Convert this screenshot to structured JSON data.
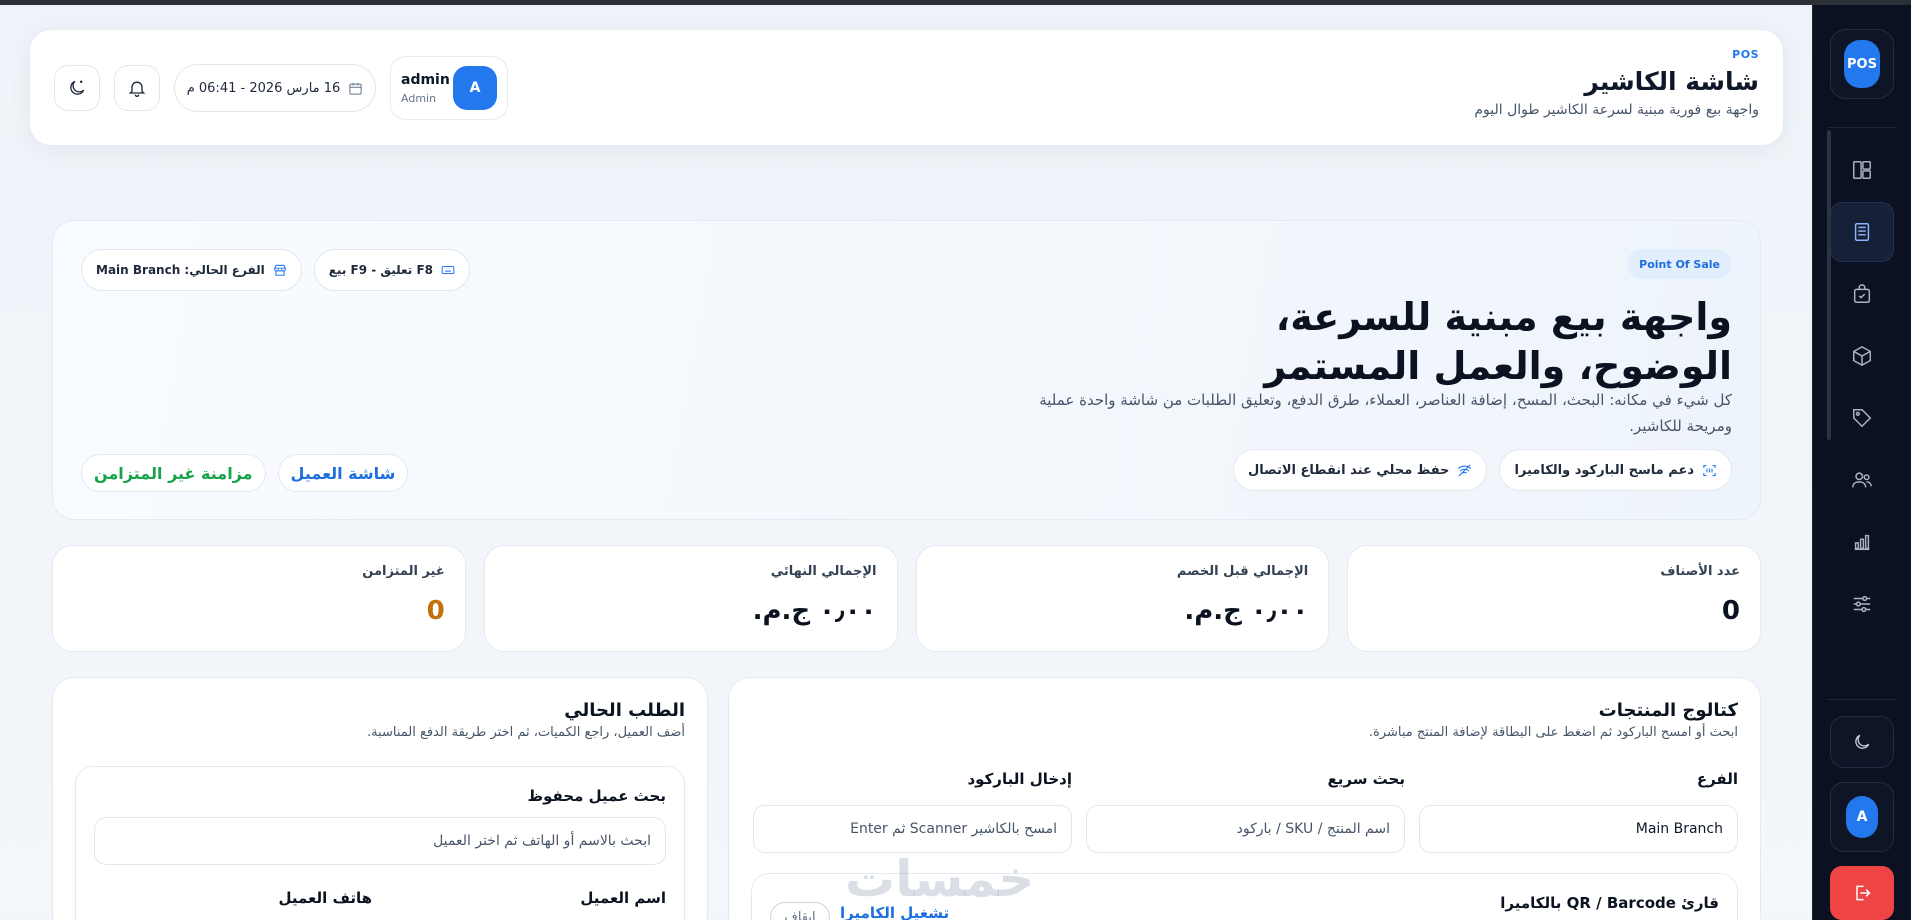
{
  "header": {
    "kicker": "POS",
    "title": "شاشة الكاشير",
    "subtitle": "واجهة بيع فورية مبنية لسرعة الكاشير طوال اليوم",
    "datetime": "16 مارس 2026 - 06:41 م",
    "user": {
      "name": "admin",
      "role": "Admin",
      "initial": "A"
    },
    "icons": [
      "moon-icon",
      "bell-icon",
      "calendar-icon"
    ]
  },
  "sidebar": {
    "logo": "POS",
    "items": [
      {
        "id": "dashboard",
        "icon": "layout-icon",
        "active": false
      },
      {
        "id": "pos",
        "icon": "register-icon",
        "active": true
      },
      {
        "id": "orders",
        "icon": "bag-icon",
        "active": false
      },
      {
        "id": "products",
        "icon": "box-icon",
        "active": false
      },
      {
        "id": "tags",
        "icon": "tag-icon",
        "active": false
      },
      {
        "id": "customers",
        "icon": "users-icon",
        "active": false
      },
      {
        "id": "reports",
        "icon": "chart-icon",
        "active": false
      },
      {
        "id": "settings",
        "icon": "sliders-icon",
        "active": false
      }
    ],
    "avatar_initial": "A"
  },
  "hero": {
    "badge": "Point Of Sale",
    "title": "واجهة بيع مبنية للسرعة، الوضوح، والعمل المستمر",
    "description": "كل شيء في مكانه: البحث، المسح، إضافة العناصر، العملاء، طرق الدفع، وتعليق الطلبات من شاشة واحدة عملية ومريحة للكاشير.",
    "tags": [
      "دعم ماسح الباركود والكاميرا",
      "حفظ محلي عند انقطاع الاتصال"
    ],
    "shortcuts": "F8 تعليق - F9 بيع",
    "branch": "الفرع الحالي: Main Branch",
    "actions": {
      "customer_screen": "شاشة العميل",
      "async_sync": "مزامنة غير المتزامن"
    }
  },
  "stats": [
    {
      "label": "عدد الأصناف",
      "value": "0"
    },
    {
      "label": "الإجمالي قبل الخصم",
      "value": "٠٫٠٠ ج.م."
    },
    {
      "label": "الإجمالي النهائي",
      "value": "٠٫٠٠ ج.م."
    },
    {
      "label": "غير المتزامن",
      "value": "0"
    }
  ],
  "catalog": {
    "title": "كتالوج المنتجات",
    "subtitle": "ابحث أو امسح الباركود ثم اضغط على البطاقة لإضافة المنتج مباشرة.",
    "branch_label": "الفرع",
    "branch_value": "Main Branch",
    "search_label": "بحث سريع",
    "search_placeholder": "اسم المنتج / SKU / باركود",
    "barcode_label": "إدخال الباركود",
    "barcode_placeholder": "امسح بالكاشير Scanner ثم Enter",
    "scanner_title": "قارئ QR / Barcode بالكاميرا",
    "scanner_start": "تشغيل الكاميرا",
    "scanner_stop": "إيقاف"
  },
  "order": {
    "title": "الطلب الحالي",
    "subtitle": "أضف العميل، راجع الكميات، ثم اختر طريقة الدفع المناسبة.",
    "search_label": "بحث عميل محفوظ",
    "search_placeholder": "ابحث بالاسم أو الهاتف ثم اختر العميل",
    "name_label": "اسم العميل",
    "phone_label": "هاتف العميل"
  },
  "watermark": "خمسات"
}
